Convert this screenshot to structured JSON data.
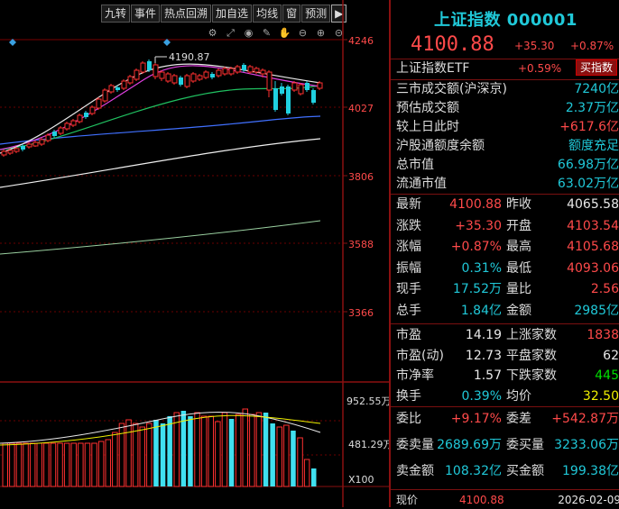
{
  "toolbar": {
    "items": [
      "九转",
      "事件",
      "热点回溯",
      "加自选",
      "均线",
      "窗",
      "预测",
      "▶"
    ]
  },
  "chart": {
    "y_ticks": [
      "4246",
      "4027",
      "3806",
      "3588",
      "3366"
    ],
    "vol_ticks": [
      "952.55万",
      "481.29万",
      "X100"
    ],
    "peak_label": "4190.87"
  },
  "info": {
    "title": "上证指数 000001",
    "price": "4100.88",
    "change": "+35.30",
    "change_pct": "+0.87%",
    "etf": {
      "label": "上证指数ETF",
      "pct": "+0.59%",
      "button": "买指数"
    },
    "turnover": {
      "label": "三市成交额(沪深京)",
      "value": "7240亿"
    },
    "est_turnover": {
      "label": "预估成交额",
      "value": "2.37万亿"
    },
    "vs_prev": {
      "label": "较上日此时",
      "value": "+617.6亿"
    },
    "margin": {
      "label": "沪股通额度余额",
      "value": "额度充足"
    },
    "total_mv": {
      "label": "总市值",
      "value": "66.98万亿"
    },
    "float_mv": {
      "label": "流通市值",
      "value": "63.02万亿"
    },
    "quote": [
      {
        "l1": "最新",
        "v1": "4100.88",
        "l2": "昨收",
        "v2": "4065.58"
      },
      {
        "l1": "涨跌",
        "v1": "+35.30",
        "l2": "开盘",
        "v2": "4103.54"
      },
      {
        "l1": "涨幅",
        "v1": "+0.87%",
        "l2": "最高",
        "v2": "4105.68"
      },
      {
        "l1": "振幅",
        "v1": "0.31%",
        "l2": "最低",
        "v2": "4093.06"
      },
      {
        "l1": "现手",
        "v1": "17.52万",
        "l2": "量比",
        "v2": "2.56"
      },
      {
        "l1": "总手",
        "v1": "1.84亿",
        "l2": "金额",
        "v2": "2985亿"
      }
    ],
    "market": [
      {
        "l1": "市盈",
        "v1": "14.19",
        "l2": "上涨家数",
        "v2": "1838"
      },
      {
        "l1": "市盈(动)",
        "v1": "12.73",
        "l2": "平盘家数",
        "v2": "62"
      },
      {
        "l1": "市净率",
        "v1": "1.57",
        "l2": "下跌家数",
        "v2": "445"
      },
      {
        "l1": "换手",
        "v1": "0.39%",
        "l2": "均价",
        "v2": "32.50"
      }
    ],
    "order": [
      {
        "l1": "委比",
        "v1": "+9.17%",
        "l2": "委差",
        "v2": "+542.87万"
      },
      {
        "l1": "委卖量",
        "v1": "2689.69万",
        "l2": "委买量",
        "v2": "3233.06万"
      },
      {
        "l1": "卖金额",
        "v1": "108.32亿",
        "l2": "买金额",
        "v2": "199.38亿"
      }
    ],
    "now": {
      "label": "现价",
      "price": "4100.88",
      "date": "2026-02-09"
    }
  }
}
